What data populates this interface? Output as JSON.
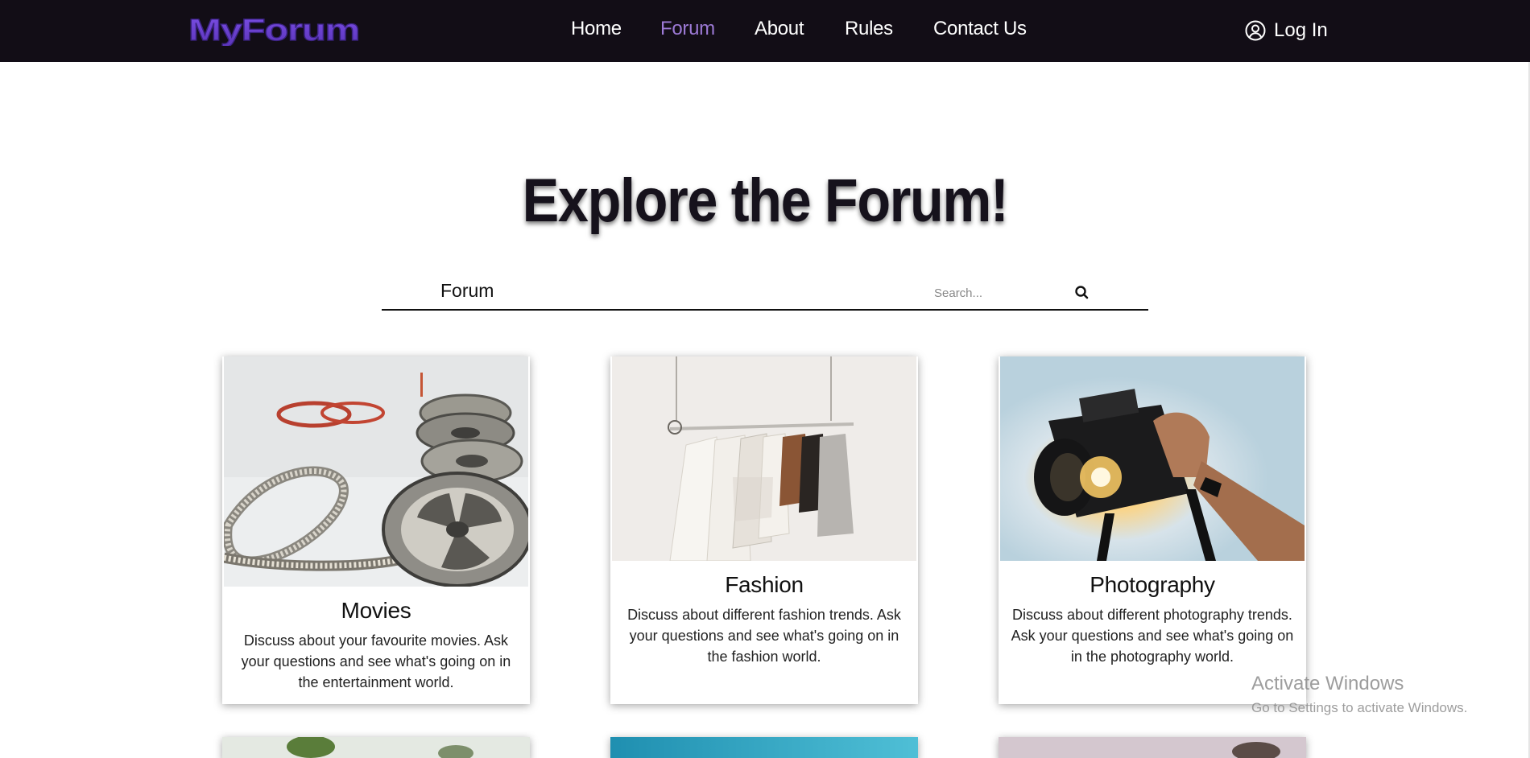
{
  "navbar": {
    "logo_text": "MyForum",
    "links": [
      "Home",
      "Forum",
      "About",
      "Rules",
      "Contact Us"
    ],
    "active": "Forum",
    "login_label": "Log In"
  },
  "hero": {
    "title": "Explore the Forum!"
  },
  "search": {
    "label": "Forum",
    "placeholder": "Search..."
  },
  "cards": [
    {
      "title": "Movies",
      "description": "Discuss about your favourite movies. Ask your questions and see what's going on in the entertainment world."
    },
    {
      "title": "Fashion",
      "description": "Discuss about different fashion trends. Ask your questions and see what's going on in the fashion world."
    },
    {
      "title": "Photography",
      "description": "Discuss about different photography trends. Ask your questions and see what's going on in the photography world."
    }
  ],
  "watermark": {
    "title": "Activate Windows",
    "subtitle": "Go to Settings to activate Windows."
  },
  "colors": {
    "navbar_bg": "#120d16",
    "accent": "#9d7ad6",
    "logo_purple": "#6b3fd1"
  }
}
